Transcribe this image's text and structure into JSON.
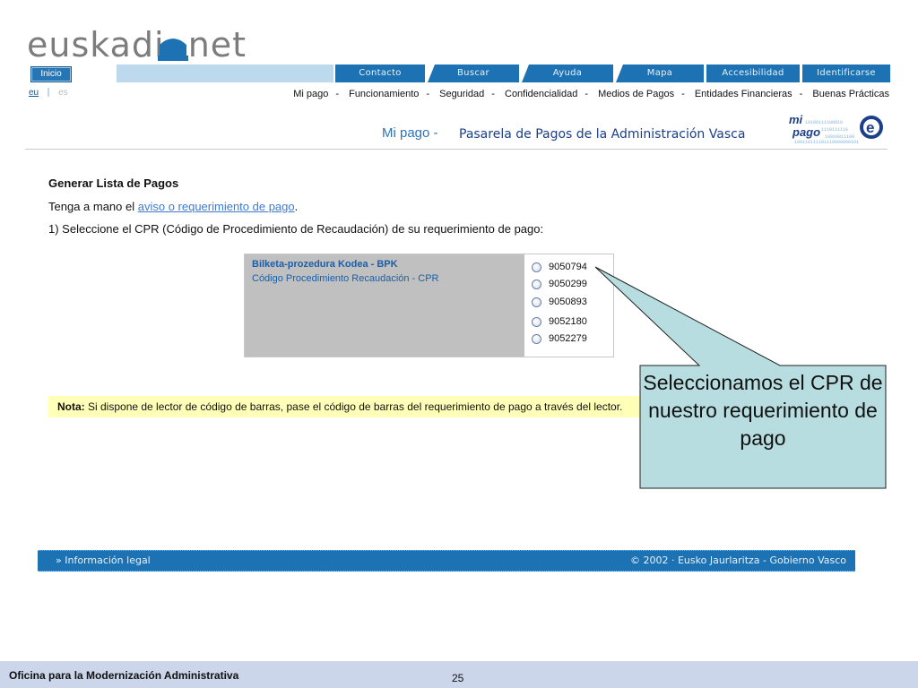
{
  "header": {
    "logo_text": "euskadi.net",
    "inicio_label": "Inicio",
    "nav_tabs": [
      "Contacto",
      "Buscar",
      "Ayuda",
      "Mapa",
      "Accesibilidad",
      "Identificarse"
    ],
    "lang_eu": "eu",
    "lang_es": "es",
    "top_menu": [
      "Mi pago",
      "Funcionamiento",
      "Seguridad",
      "Confidencialidad",
      "Medios de Pagos",
      "Entidades Financieras",
      "Buenas Prácticas"
    ],
    "menu_separator": "-"
  },
  "title": {
    "mipago": "Mi pago -",
    "pasarela": "Pasarela de Pagos de la Administración Vasca",
    "logo_mi": "mi",
    "logo_pago": "pago",
    "logo_e": "e"
  },
  "content": {
    "heading": "Generar Lista de Pagos",
    "line1_prefix": "Tenga a mano el ",
    "line1_link": "aviso o requerimiento de pago",
    "line1_suffix": ".",
    "line2": "1) Seleccione el  CPR (Código de Procedimiento de Recaudación) de su requerimiento de pago:",
    "cpr_title": "Bilketa-prozedura Kodea - BPK",
    "cpr_sub": "Código Procedimiento Recaudación - CPR",
    "cpr_options": [
      "9050794",
      "9050299",
      "9050893",
      "9052180",
      "9052279"
    ],
    "nota_label": "Nota:",
    "nota_text": " Si dispone de lector de código de barras, pase el código de barras del requerimiento de pago a través del lector."
  },
  "callout": {
    "text": "Seleccionamos el CPR de nuestro requerimiento de pago"
  },
  "footer": {
    "legal": "» Información legal",
    "copyright": "© 2002 · Eusko Jaurlaritza - Gobierno Vasco"
  },
  "slide": {
    "org": "Oficina para la Modernización Administrativa",
    "page": "25"
  },
  "colors": {
    "nav_blue": "#1d72b3",
    "nav_light": "#bcd9ee",
    "callout_fill": "#b7dde0",
    "nota_bg": "#ffffb7",
    "slide_footer": "#cbd6ea"
  }
}
